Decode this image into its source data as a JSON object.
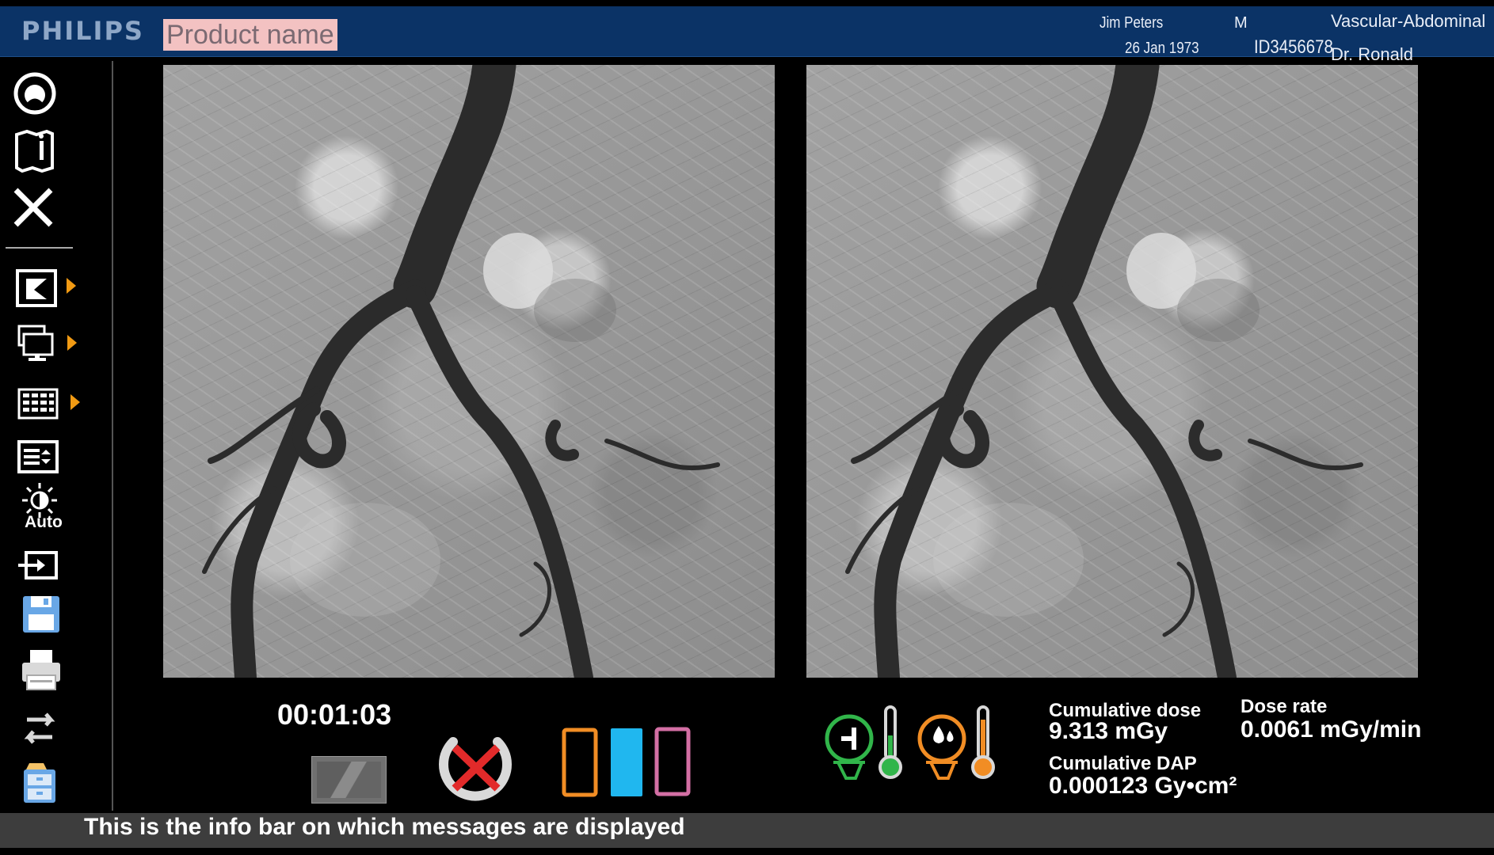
{
  "header": {
    "brand": "PHILIPS",
    "product_name": "Product name",
    "patient_name": "Jim Peters",
    "patient_dob": "26 Jan 1973",
    "patient_sex": "M",
    "patient_id": "ID3456678",
    "exam": "Vascular-Abdominal",
    "doctor": "Dr. Ronald"
  },
  "sidebar": {
    "auto_label": "Auto"
  },
  "status": {
    "elapsed_time": "00:01:03",
    "cumulative_dose_label": "Cumulative dose",
    "cumulative_dose_value": "9.313 mGy",
    "dose_rate_label": "Dose rate",
    "dose_rate_value": "0.0061 mGy/min",
    "cumulative_dap_label": "Cumulative DAP",
    "cumulative_dap_value": "0.000123 Gy•cm²"
  },
  "info_bar": {
    "message": "This is the info bar on which messages are displayed"
  },
  "colors": {
    "header_blue": "#0b3366",
    "arrow_orange": "#f19a13",
    "green": "#31b54a",
    "orange": "#f18d24",
    "cyan": "#20b7ef",
    "pink": "#d36fa4",
    "red": "#e22a2a"
  }
}
